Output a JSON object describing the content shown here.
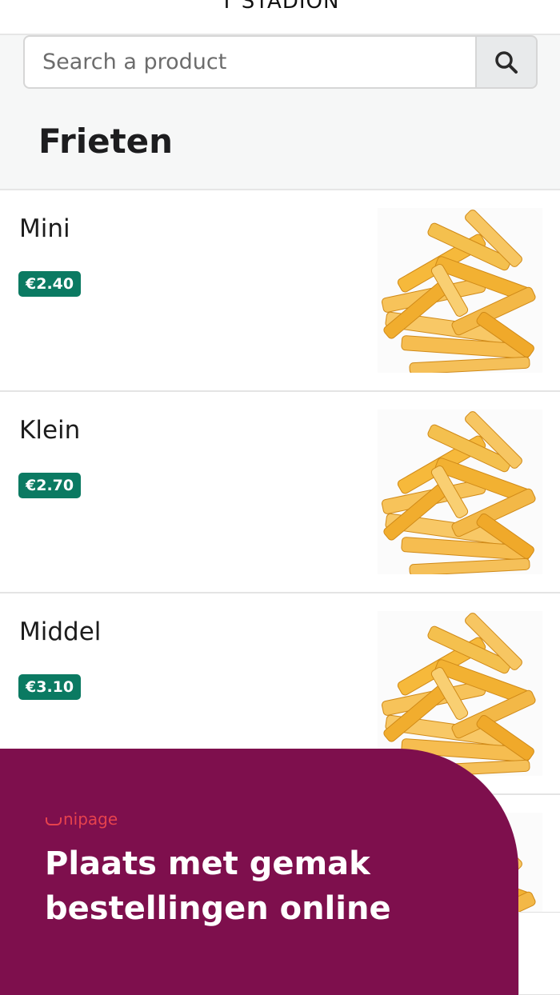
{
  "header": {
    "title": "T STADION"
  },
  "search": {
    "placeholder": "Search a product",
    "icon": "search-icon"
  },
  "category": {
    "title": "Frieten"
  },
  "products": [
    {
      "name": "Mini",
      "price": "€2.40",
      "image": "fries-image"
    },
    {
      "name": "Klein",
      "price": "€2.70",
      "image": "fries-image"
    },
    {
      "name": "Middel",
      "price": "€3.10",
      "image": "fries-image"
    },
    {
      "name": "",
      "price": "",
      "image": "fries-image"
    }
  ],
  "promo": {
    "logo_text": "nipage",
    "headline": "Plaats met gemak bestellingen online"
  },
  "colors": {
    "price_badge": "#0b7a62",
    "promo_bg": "#7e0f4d",
    "logo": "#e6424d"
  }
}
